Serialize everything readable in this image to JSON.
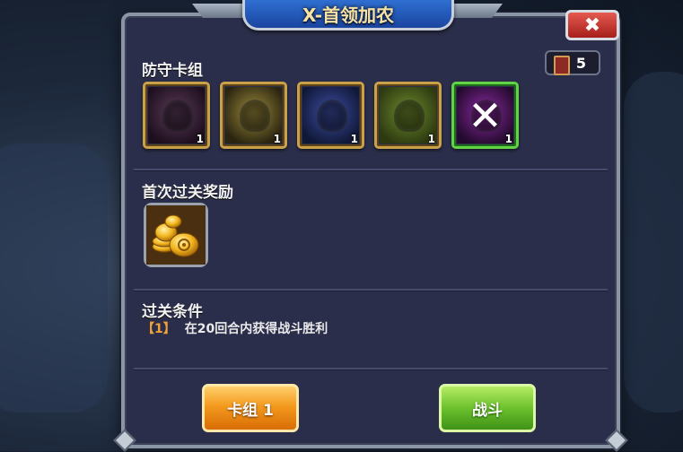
{
  "title": "X-首领加农",
  "close_label": "✖",
  "sections": {
    "defense_deck": {
      "label": "防守卡组",
      "deck_count": "5",
      "cards": [
        {
          "icon": "spiky-bomb-monster-icon",
          "qty": "1",
          "frame": "gold",
          "c1": "#5b3b5a",
          "c2": "#1d0f1d"
        },
        {
          "icon": "cracked-egg-monster-icon",
          "qty": "1",
          "frame": "gold",
          "c1": "#9a8a3b",
          "c2": "#2a2410"
        },
        {
          "icon": "dark-witch-monster-icon",
          "qty": "1",
          "frame": "gold",
          "c1": "#3d4da0",
          "c2": "#101838"
        },
        {
          "icon": "winged-dragon-monster-icon",
          "qty": "1",
          "frame": "gold",
          "c1": "#6e8a2e",
          "c2": "#2d3a10"
        },
        {
          "icon": "crossed-swords-mage-icon",
          "qty": "1",
          "frame": "green",
          "c1": "#8a2aa0",
          "c2": "#240a2e"
        }
      ]
    },
    "first_clear_reward": {
      "label": "首次过关奖励",
      "icon": "gold-coins-icon"
    },
    "clear_condition": {
      "label": "过关条件",
      "items": [
        {
          "index": "【1】",
          "text": "在20回合内获得战斗胜利"
        }
      ]
    }
  },
  "buttons": {
    "deck": "卡组  1",
    "fight": "战斗"
  }
}
